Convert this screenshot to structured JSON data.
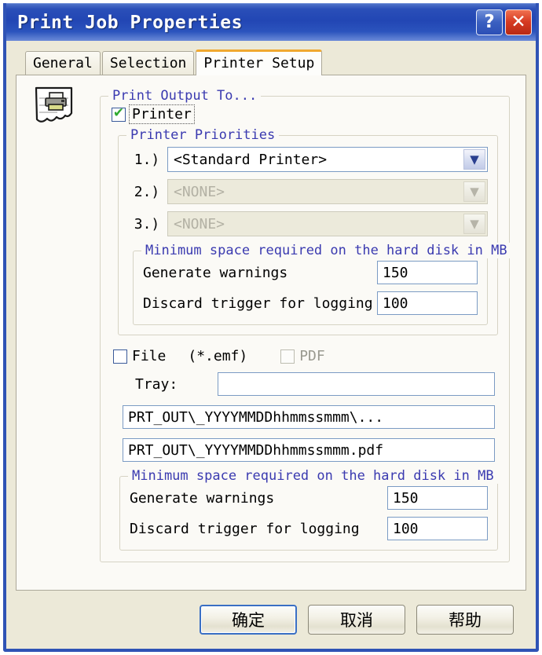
{
  "window": {
    "title": "Print Job Properties",
    "help_button": "?",
    "close_button": "✕"
  },
  "tabs": [
    {
      "label": "General",
      "active": false
    },
    {
      "label": "Selection",
      "active": false
    },
    {
      "label": "Printer Setup",
      "active": true
    }
  ],
  "print_output": {
    "legend": "Print Output To...",
    "printer_checkbox": {
      "label": "Printer",
      "checked": true,
      "check_glyph": "✔"
    }
  },
  "priorities": {
    "legend": "Printer Priorities",
    "rows": [
      {
        "num": "1.)",
        "value": "<Standard Printer>",
        "disabled": false
      },
      {
        "num": "2.)",
        "value": "<NONE>",
        "disabled": true
      },
      {
        "num": "3.)",
        "value": "<NONE>",
        "disabled": true
      }
    ],
    "arrow_glyph": "▼"
  },
  "minspace_printer": {
    "legend": "Minimum space required on the hard disk in MB",
    "rows": [
      {
        "label": "Generate warnings",
        "value": "150"
      },
      {
        "label": "Discard trigger for logging",
        "value": "100"
      }
    ]
  },
  "file_section": {
    "file_checkbox": {
      "label": "File",
      "checked": false
    },
    "extension": "(*.emf)",
    "pdf_checkbox": {
      "label": "PDF",
      "checked": false,
      "disabled": true
    },
    "tray_label": "Tray:",
    "tray_value": "",
    "path_emf": "PRT_OUT\\_YYYYMMDDhhmmssmmm\\...",
    "path_pdf": "PRT_OUT\\_YYYYMMDDhhmmssmmm.pdf"
  },
  "minspace_file": {
    "legend": "Minimum space required on the hard disk in MB",
    "rows": [
      {
        "label": "Generate warnings",
        "value": "150"
      },
      {
        "label": "Discard trigger for logging",
        "value": "100"
      }
    ]
  },
  "footer": {
    "ok": "确定",
    "cancel": "取消",
    "help": "帮助"
  },
  "colors": {
    "titlebar_blue": "#2246b4",
    "frame_blue": "#2f53b5",
    "dialog_bg": "#ece9d8",
    "panel_bg": "#fbfaf6",
    "legend_blue": "#3a3ab0",
    "active_tab_accent": "#f0a830",
    "close_red": "#d63a22",
    "check_green": "#2faa2f"
  }
}
